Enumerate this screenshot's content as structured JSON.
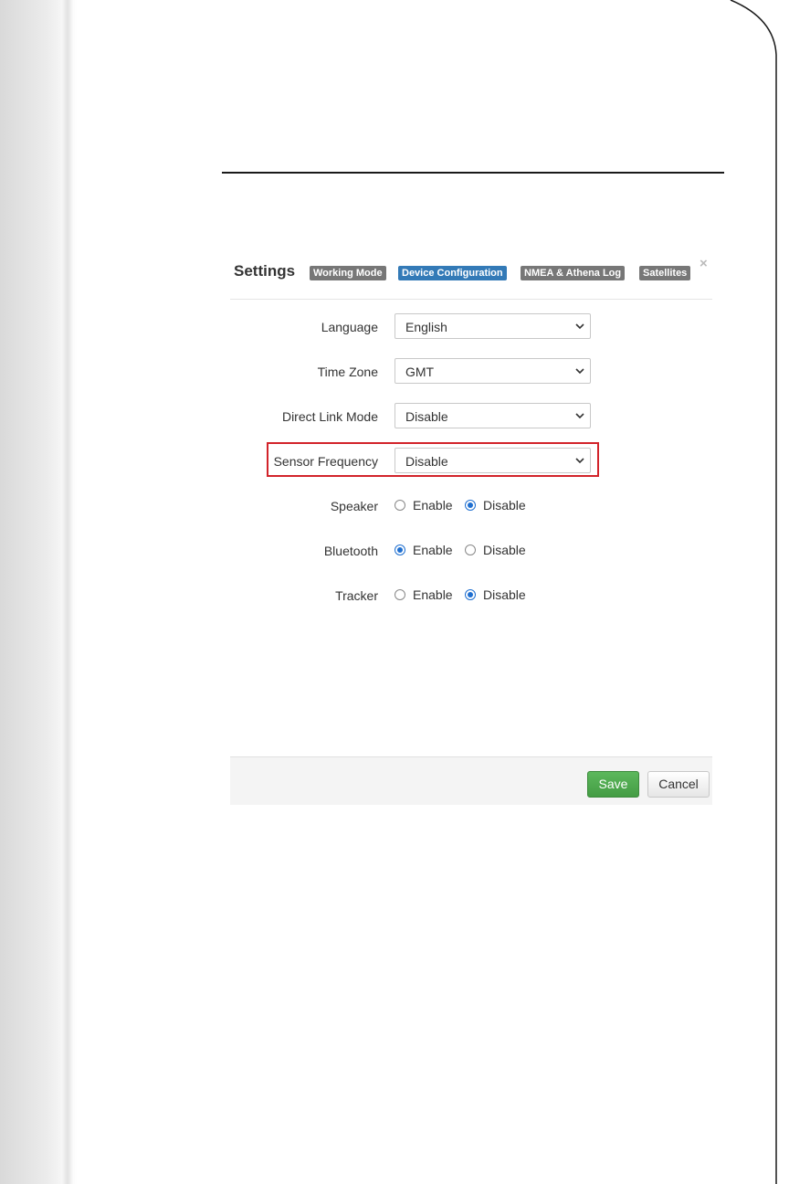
{
  "modal": {
    "title": "Settings",
    "tabs": [
      {
        "label": "Working Mode",
        "active": false
      },
      {
        "label": "Device Configuration",
        "active": true
      },
      {
        "label": "NMEA & Athena Log",
        "active": false
      },
      {
        "label": "Satellites",
        "active": false
      }
    ],
    "close_glyph": "×"
  },
  "form": {
    "language": {
      "label": "Language",
      "value": "English"
    },
    "time_zone": {
      "label": "Time Zone",
      "value": "GMT"
    },
    "direct_link_mode": {
      "label": "Direct Link Mode",
      "value": "Disable"
    },
    "sensor_frequency": {
      "label": "Sensor Frequency",
      "value": "Disable",
      "highlighted": true
    },
    "speaker": {
      "label": "Speaker",
      "options": [
        "Enable",
        "Disable"
      ],
      "selected": "Disable"
    },
    "bluetooth": {
      "label": "Bluetooth",
      "options": [
        "Enable",
        "Disable"
      ],
      "selected": "Enable"
    },
    "tracker": {
      "label": "Tracker",
      "options": [
        "Enable",
        "Disable"
      ],
      "selected": "Disable"
    }
  },
  "footer": {
    "save_label": "Save",
    "cancel_label": "Cancel"
  },
  "colors": {
    "tab_active": "#337ab7",
    "tab_inactive": "#777777",
    "save_button": "#5cb85c",
    "highlight_border": "#d2232a",
    "radio_checked": "#1f6fd0"
  },
  "icons": {
    "select_arrow": "chevron-down-icon",
    "close": "close-icon"
  }
}
